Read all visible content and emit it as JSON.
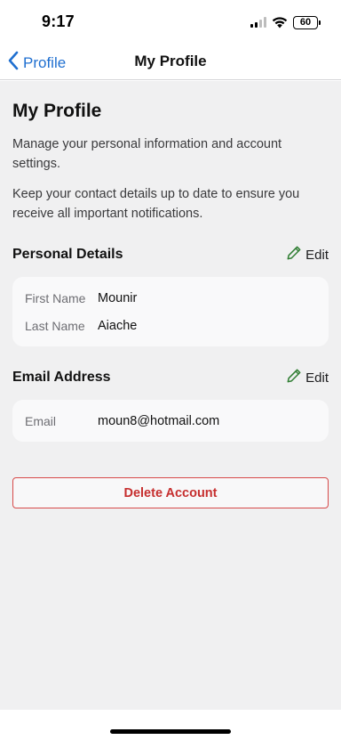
{
  "status_bar": {
    "time": "9:17",
    "battery": "60"
  },
  "nav": {
    "back_label": "Profile",
    "title": "My Profile"
  },
  "page": {
    "heading": "My Profile",
    "description_1": "Manage your personal information and account settings.",
    "description_2": "Keep your contact details up to date to ensure you receive all important notifications."
  },
  "personal_details": {
    "title": "Personal Details",
    "edit_label": "Edit",
    "fields": [
      {
        "label": "First Name",
        "value": "Mounir"
      },
      {
        "label": "Last Name",
        "value": "Aiache"
      }
    ]
  },
  "email_address": {
    "title": "Email Address",
    "edit_label": "Edit",
    "fields": [
      {
        "label": "Email",
        "value": "moun8@hotmail.com"
      }
    ]
  },
  "actions": {
    "delete_label": "Delete Account"
  },
  "colors": {
    "accent": "#1f6fd0",
    "danger": "#c62f2f",
    "background": "#f0f0f1",
    "card": "#f9f9fa"
  },
  "icons": [
    "chevron-left-icon",
    "pencil-icon",
    "signal-icon",
    "wifi-icon",
    "battery-icon"
  ]
}
